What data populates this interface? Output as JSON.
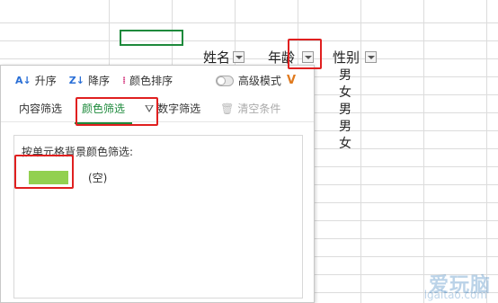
{
  "sheet": {
    "headers": [
      {
        "label": "姓名"
      },
      {
        "label": "年龄"
      },
      {
        "label": "性别"
      }
    ],
    "gender_values": [
      "男",
      "女",
      "男",
      "男",
      "女"
    ]
  },
  "toolbar": {
    "sort_asc": "升序",
    "sort_desc": "降序",
    "sort_color": "颜色排序",
    "advanced_mode": "高级模式"
  },
  "tabs": {
    "content_filter": "内容筛选",
    "color_filter": "颜色筛选",
    "number_filter": "数字筛选",
    "clear": "清空条件"
  },
  "color_panel": {
    "caption": "按单元格背景颜色筛选:",
    "swatch_color": "#92d050",
    "empty_label": "(空)"
  },
  "watermark": {
    "title": "爱玩脑",
    "url": "lgaitao.com"
  },
  "colors": {
    "accent": "#1e8a3c",
    "highlight": "#e02020"
  }
}
